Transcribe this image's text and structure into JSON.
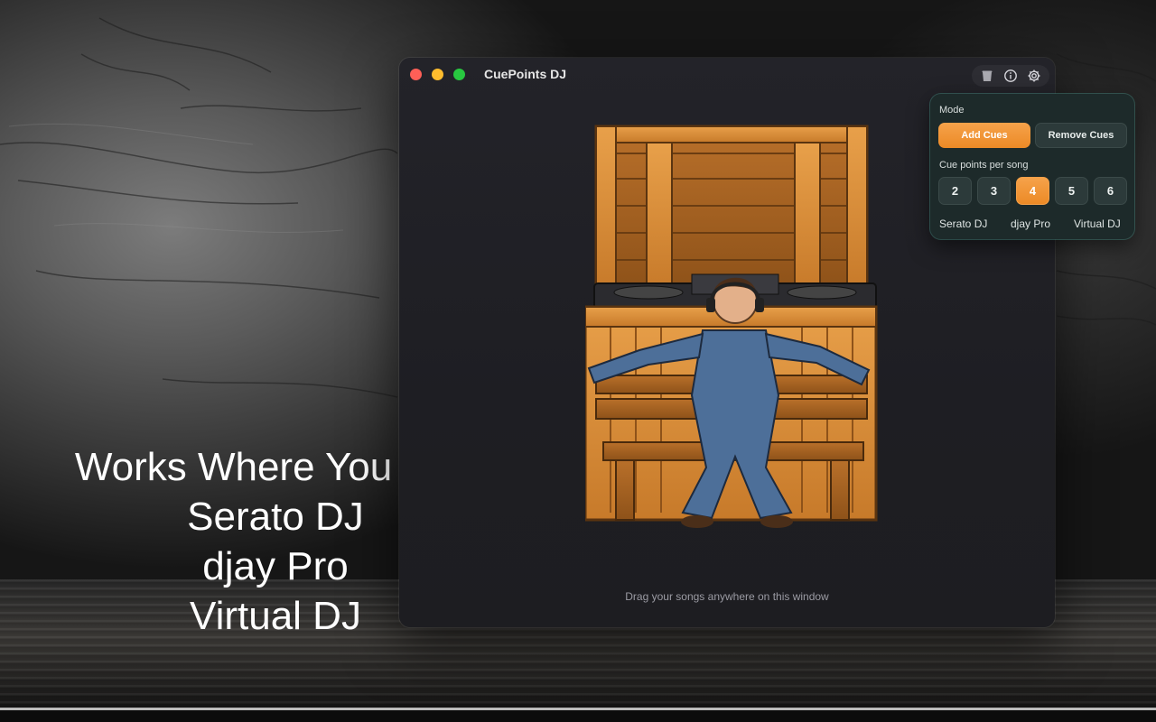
{
  "headline": {
    "line1": "Works Where You Mix.",
    "line2": "Serato DJ",
    "line3": "djay Pro",
    "line4": "Virtual DJ"
  },
  "window": {
    "title": "CuePoints DJ",
    "toolbar_icons": [
      "trash-icon",
      "info-icon",
      "gear-icon"
    ],
    "drop_hint": "Drag your songs anywhere on this window"
  },
  "settings": {
    "mode_label": "Mode",
    "add_cues": "Add Cues",
    "remove_cues": "Remove Cues",
    "active_mode": "Add Cues",
    "cues_label": "Cue points per song",
    "cue_options": [
      "2",
      "3",
      "4",
      "5",
      "6"
    ],
    "selected_cues": "4",
    "platforms": [
      "Serato DJ",
      "djay Pro",
      "Virtual DJ"
    ]
  },
  "colors": {
    "accent": "#ec8a26",
    "popover_bg": "#1d2a2a",
    "window_bg": "#1f1f24"
  }
}
